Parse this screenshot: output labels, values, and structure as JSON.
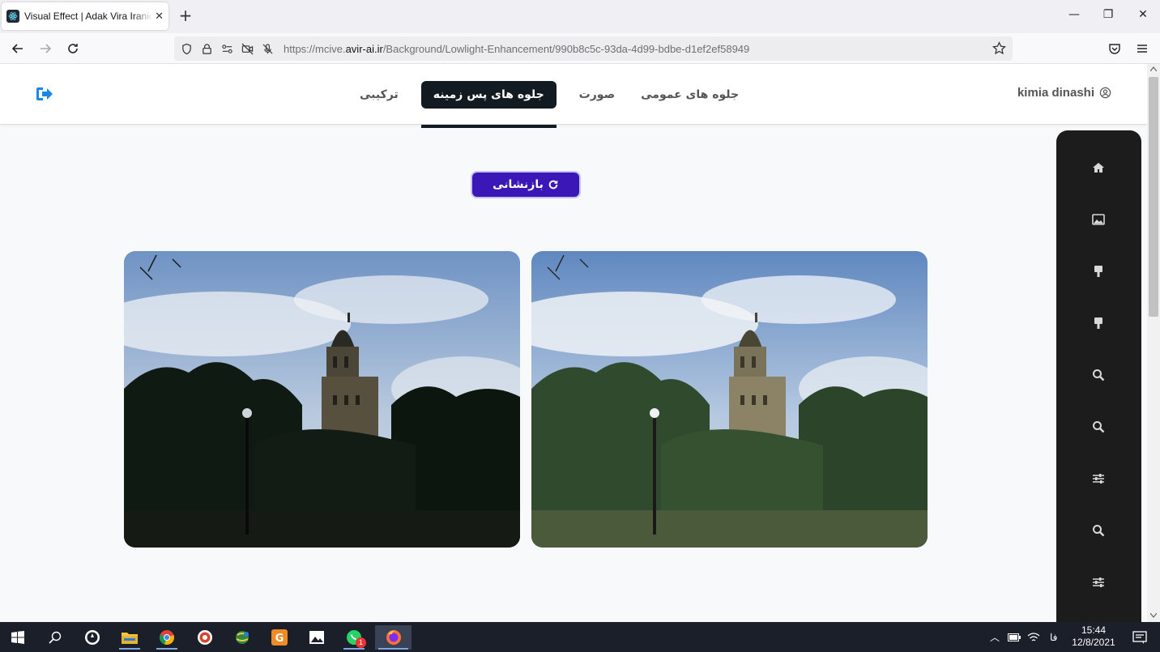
{
  "browser": {
    "tab_title": "Visual Effect | Adak Vira Iranidan",
    "url_prefix": "https://mcive.",
    "url_domain": "avir-ai.ir",
    "url_path": "/Background/Lowlight-Enhancement/990b8c5c-93da-4d99-bdbe-d1ef2ef58949"
  },
  "header": {
    "user_name": "kimia dinashi",
    "menu": [
      {
        "label": "جلوه های عمومی"
      },
      {
        "label": "صورت"
      },
      {
        "label": "جلوه های پس زمینه",
        "active": true
      },
      {
        "label": "ترکیبی"
      }
    ]
  },
  "main": {
    "reset_label": "بازنشانی",
    "images": [
      "low-light original",
      "enhanced result"
    ]
  },
  "sidebar": {
    "icons": [
      "home-icon",
      "image-icon",
      "brush-icon",
      "brush-icon",
      "search-icon",
      "search-icon",
      "sliders-icon",
      "search-icon",
      "sliders-icon"
    ]
  },
  "taskbar": {
    "lang": "فا",
    "time": "15:44",
    "date": "12/8/2021",
    "whatsapp_badge": "1"
  },
  "colors": {
    "accent_purple": "#3c17b8",
    "active_tab": "#131b22",
    "sidebar_bg": "#1c1c1c",
    "logout_blue": "#1a88e8"
  }
}
